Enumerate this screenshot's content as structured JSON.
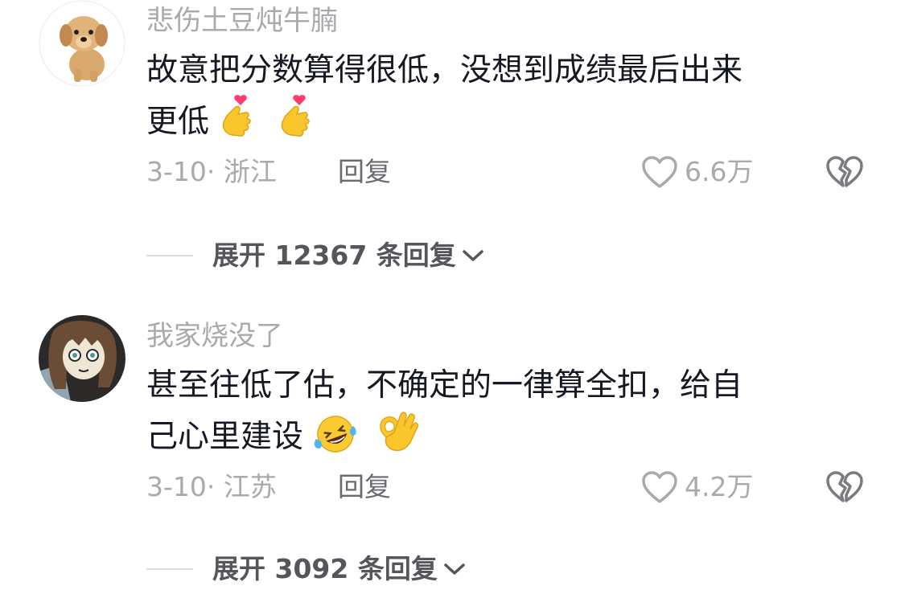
{
  "comments": [
    {
      "username": "悲伤土豆炖牛腩",
      "text_line1": "故意把分数算得很低，没想到成绩最后出来",
      "text_line2": "更低",
      "emojis": [
        "finger-heart-emoji",
        "finger-heart-emoji"
      ],
      "date_location": "3-10· 浙江",
      "reply_label": "回复",
      "likes": "6.6万",
      "expand_label": "展开 12367 条回复"
    },
    {
      "username": "我家烧没了",
      "text_line1": "甚至往低了估，不确定的一律算全扣，给自",
      "text_line2": "己心里建设",
      "emojis": [
        "rolling-laughing-emoji",
        "ok-hand-emoji"
      ],
      "date_location": "3-10· 江苏",
      "reply_label": "回复",
      "likes": "4.2万",
      "expand_label": "展开 3092 条回复"
    }
  ],
  "colors": {
    "username": "#a9a9ae",
    "text": "#161823",
    "meta": "#a9a9ae",
    "reply": "#6a6a70",
    "expand": "#55555c",
    "divider": "#dcdcdf"
  },
  "icons": [
    "heart-outline-icon",
    "broken-heart-icon",
    "chevron-down-icon"
  ]
}
